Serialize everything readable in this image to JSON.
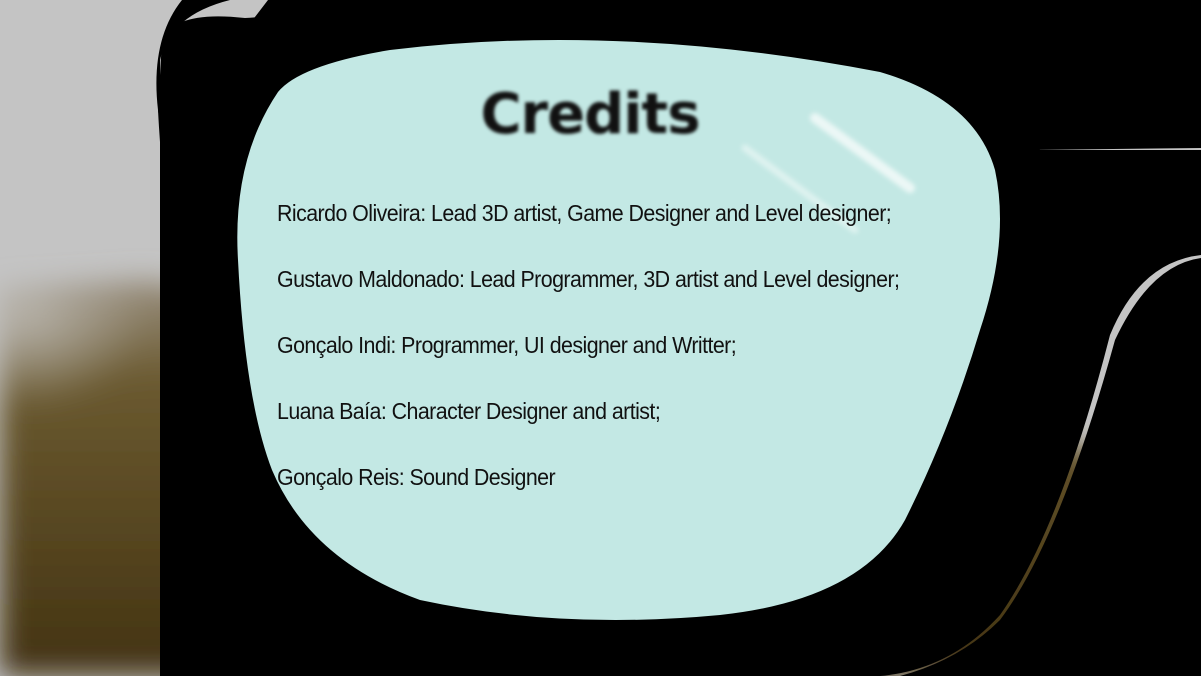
{
  "screen": {
    "title": "Credits"
  },
  "credits": [
    "Ricardo Oliveira: Lead 3D artist, Game Designer and  Level designer;",
    "Gustavo Maldonado: Lead Programmer, 3D artist and Level designer;",
    "Gonçalo Indi: Programmer, UI designer and Writter;",
    "Luana Baía: Character Designer and artist;",
    "Gonçalo Reis: Sound Designer"
  ],
  "colors": {
    "wall": "#c4c4c4",
    "table": "#4a3a14",
    "frame": "#000000",
    "lens": "#c3e8e4",
    "text": "#111111"
  }
}
